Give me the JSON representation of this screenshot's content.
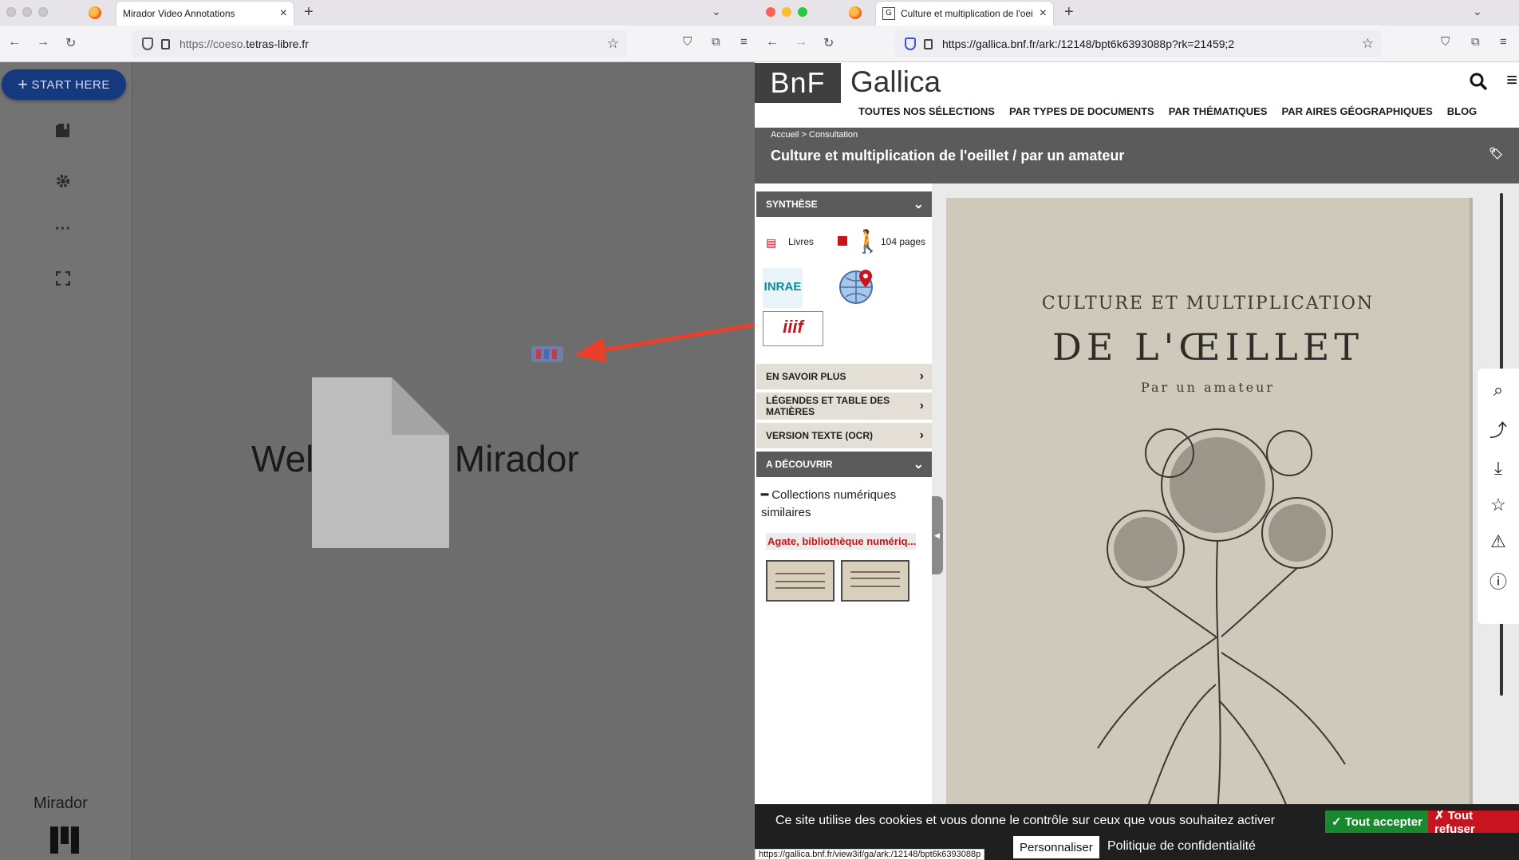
{
  "left_window": {
    "tab_title": "Mirador Video Annotations",
    "url_prefix": "https://coeso.",
    "url_domain": "tetras-libre.fr",
    "start_button": "START HERE",
    "welcome_text": "Welcome to Mirador",
    "app_name": "Mirador"
  },
  "right_window": {
    "tab_title": "Culture et multiplication de l'oeillet / par un amateur",
    "url": "https://gallica.bnf.fr/ark:/12148/bpt6k6393088p?rk=21459;2",
    "logo": "BnF",
    "site_name": "Gallica",
    "menu": [
      "TOUTES NOS SÉLECTIONS",
      "PAR TYPES DE DOCUMENTS",
      "PAR THÉMATIQUES",
      "PAR AIRES GÉOGRAPHIQUES",
      "BLOG"
    ],
    "breadcrumb": "Accueil  >  Consultation",
    "doc_title": "Culture et multiplication de l'oeillet / par un amateur",
    "synthese": "SYNTHÈSE",
    "type_label": "Livres",
    "pages_label": "104 pages",
    "inrae_label": "INRAE",
    "iiif_label": "iiif",
    "acc_en_savoir": "EN SAVOIR PLUS",
    "acc_legendes": "LÉGENDES ET TABLE DES MATIÈRES",
    "acc_version": "VERSION TEXTE (OCR)",
    "acc_decouvrir": "A DÉCOUVRIR",
    "collections_title": "Collections numériques similaires",
    "agate_label": "Agate, bibliothèque numériq...",
    "page_line1": "CULTURE ET MULTIPLICATION",
    "page_line2": "DE L'ŒILLET",
    "page_line3": "Par un amateur",
    "cookie_text": "Ce site utilise des cookies et vous donne le contrôle sur ceux que vous souhaitez activer",
    "cookie_accept": "✓ Tout accepter",
    "cookie_refuse": "✗ Tout refuser",
    "cookie_custom": "Personnaliser",
    "cookie_policy": "Politique de confidentialité",
    "status_url": "https://gallica.bnf.fr/view3if/ga/ark:/12148/bpt6k6393088p"
  },
  "colors": {
    "mirador_primary": "#15387f",
    "gallica_grey": "#5b5b5b",
    "arrow_red": "#e8402b",
    "accept_green": "#188a2e",
    "refuse_red": "#c8141e"
  }
}
